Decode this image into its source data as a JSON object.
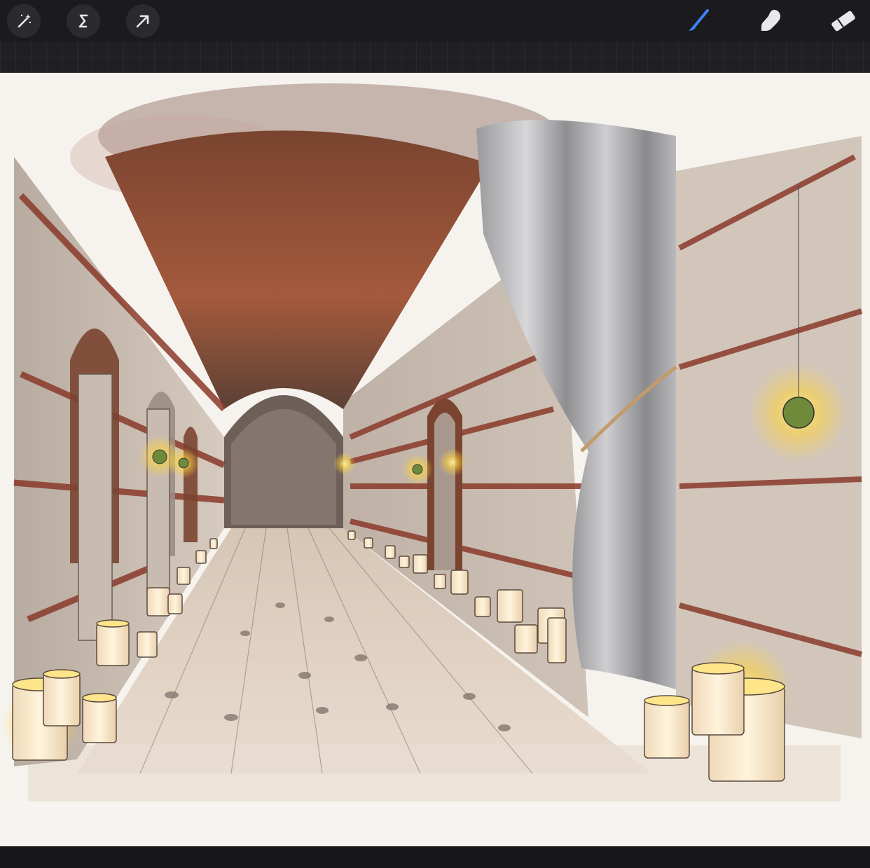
{
  "toolbar": {
    "left_tools": [
      {
        "name": "adjustments",
        "icon": "magic-wand-icon"
      },
      {
        "name": "selection",
        "icon": "selection-s-icon"
      },
      {
        "name": "transform",
        "icon": "transform-arrow-icon"
      }
    ],
    "right_tools": [
      {
        "name": "brush",
        "icon": "brush-icon",
        "active": true,
        "color": "#3b82f6"
      },
      {
        "name": "smudge",
        "icon": "smudge-finger-icon",
        "active": false
      },
      {
        "name": "eraser",
        "icon": "eraser-icon",
        "active": false
      }
    ]
  },
  "canvas": {
    "subject": "candlelit-brick-tunnel-sketch"
  },
  "colors": {
    "toolbar_bg": "#1b1b1d",
    "active_accent": "#3b82f6",
    "paper": "#f6f3ef",
    "brick": "#8a3a2a",
    "candle_glow": "#ffd43b"
  }
}
